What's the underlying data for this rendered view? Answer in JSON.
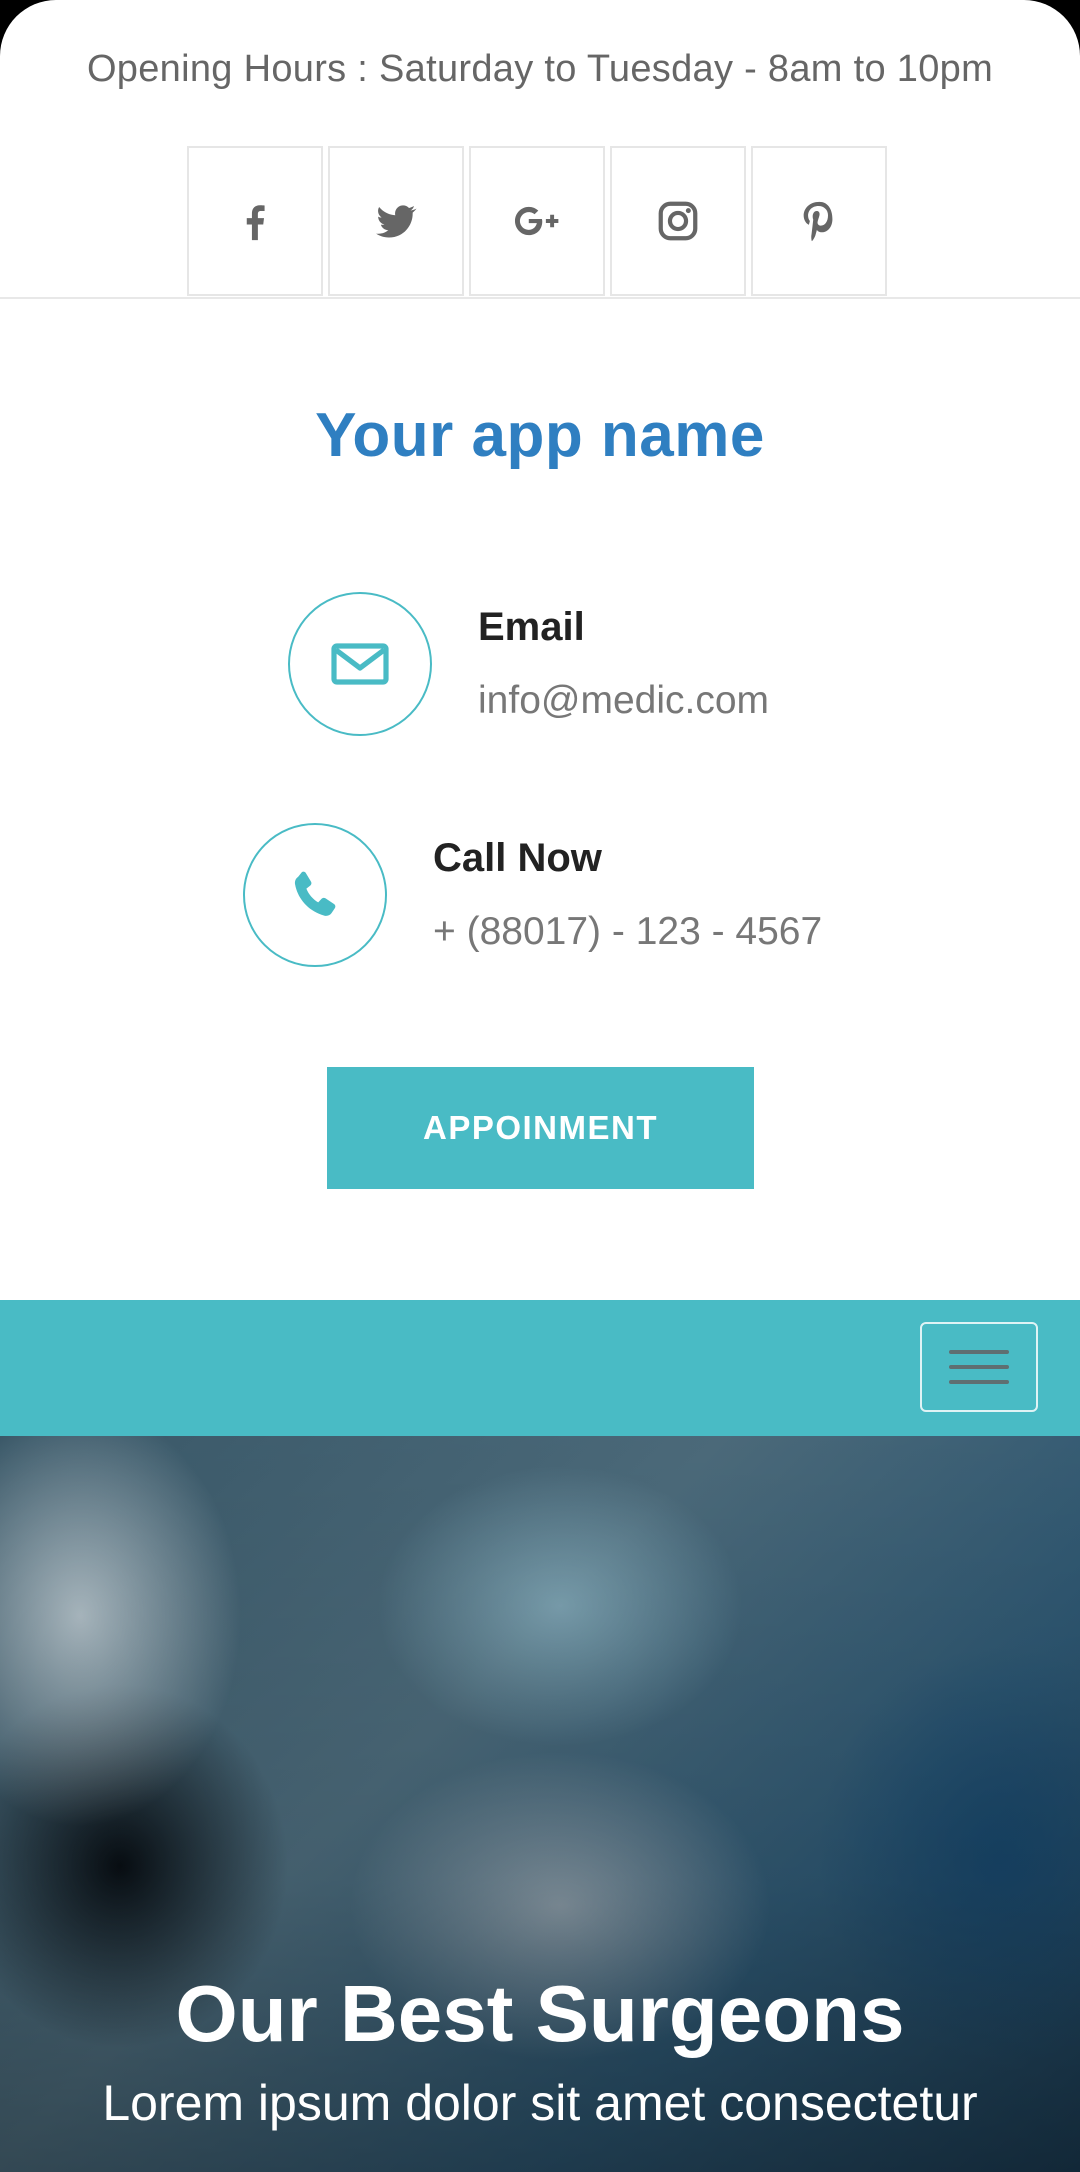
{
  "top_bar": {
    "opening_hours": "Opening Hours : Saturday to Tuesday - 8am to 10pm",
    "social": [
      {
        "icon": "facebook-icon"
      },
      {
        "icon": "twitter-icon"
      },
      {
        "icon": "google-plus-icon"
      },
      {
        "icon": "instagram-icon"
      },
      {
        "icon": "pinterest-icon"
      }
    ]
  },
  "brand": {
    "app_name": "Your app name"
  },
  "contacts": {
    "email": {
      "title": "Email",
      "value": "info@medic.com",
      "icon": "envelope-icon"
    },
    "phone": {
      "title": "Call Now",
      "value": "+ (88017) - 123 - 4567",
      "icon": "phone-icon"
    }
  },
  "cta": {
    "label": "APPOINMENT"
  },
  "navbar": {
    "menu_icon": "hamburger-menu-icon"
  },
  "hero": {
    "title": "Our Best Surgeons",
    "subtitle": "Lorem ipsum dolor sit amet consectetur"
  },
  "colors": {
    "accent": "#49bbc5",
    "brand": "#2f7fc1",
    "text_dark": "#222222",
    "text_muted": "#777777"
  }
}
